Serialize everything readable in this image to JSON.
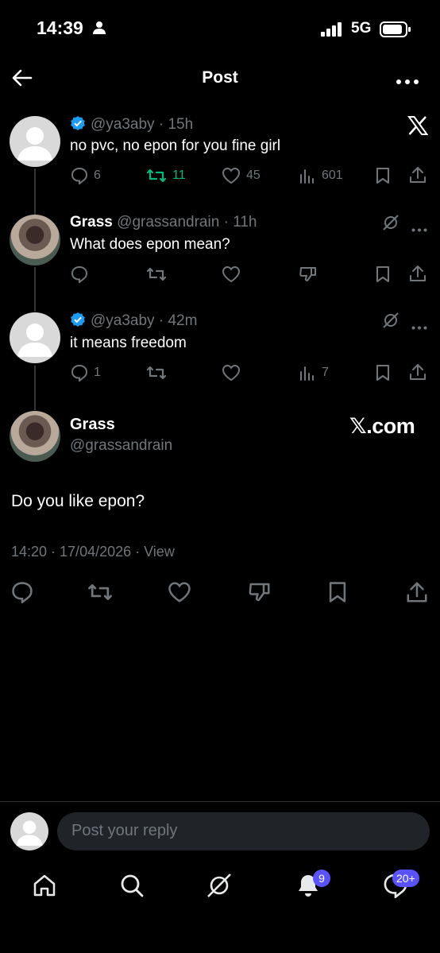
{
  "status": {
    "time": "14:39",
    "network": "5G"
  },
  "header": {
    "title": "Post"
  },
  "thread": [
    {
      "name": "",
      "handle": "@ya3aby",
      "time": "15h",
      "text": "no pvc, no epon for you fine girl",
      "replies": "6",
      "reposts": "11",
      "likes": "45",
      "views": "601"
    },
    {
      "name": "Grass",
      "handle": "@grassandrain",
      "time": "11h",
      "text": "What does epon mean?"
    },
    {
      "name": "",
      "handle": "@ya3aby",
      "time": "42m",
      "text": "it means freedom",
      "replies": "1",
      "views": "7"
    }
  ],
  "main_post": {
    "name": "Grass",
    "handle": "@grassandrain",
    "text": "Do you like epon?",
    "timestamp": "14:20 · 17/04/2026 · View",
    "brand": "𝕏.com"
  },
  "reply_box": {
    "placeholder": "Post your reply"
  },
  "bottom_nav": {
    "notifications_badge": "9",
    "messages_badge": "20+"
  },
  "colors": {
    "background": "#000000",
    "accent": "#1d9bf0",
    "repost_green": "#00ba7c",
    "badge": "#5a52ff"
  }
}
